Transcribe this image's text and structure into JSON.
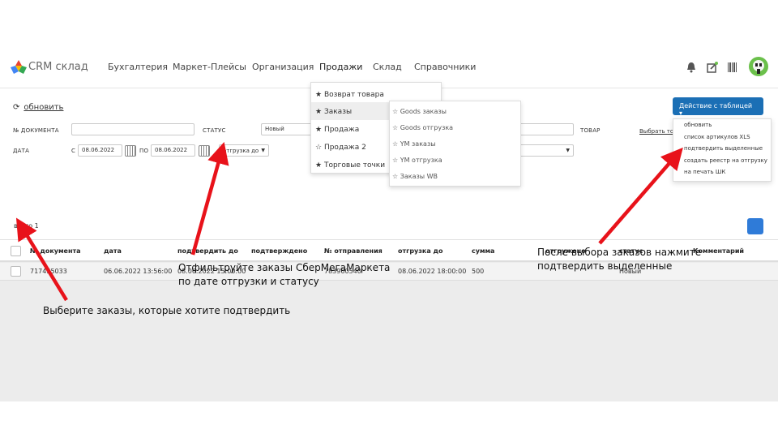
{
  "brand": "CRM склад",
  "menu": [
    {
      "label": "Бухгалтерия"
    },
    {
      "label": "Маркет-Плейсы"
    },
    {
      "label": "Организация"
    },
    {
      "label": "Продажи"
    },
    {
      "label": "Склад"
    },
    {
      "label": "Справочники"
    }
  ],
  "toolbar": {
    "refresh_label": "обновить"
  },
  "filters": {
    "doc_label": "№ ДОКУМЕНТА",
    "status_label": "СТАТУС",
    "status_value": "Новый",
    "date_label": "ДАТА",
    "from_prefix": "С",
    "from_value": "08.06.2022",
    "to_prefix": "ПО",
    "to_value": "08.06.2022",
    "date_type": "отгрузка до",
    "goods_label": "ТОВАР",
    "select_goods_link": "Выбрать тов"
  },
  "total": "всего 1",
  "action": {
    "button_label": "Действие с таблицей ▾",
    "items": [
      "обновить",
      "список артикулов XLS",
      "подтвердить выделенные",
      "создать реестр на отгрузку",
      "на печать ШК"
    ]
  },
  "sales_menu": {
    "items": [
      {
        "icon": "★",
        "label": "Возврат товара"
      },
      {
        "icon": "★",
        "label": "Заказы"
      },
      {
        "icon": "★",
        "label": "Продажа"
      },
      {
        "icon": "☆",
        "label": "Продажа 2"
      },
      {
        "icon": "★",
        "label": "Торговые точки"
      }
    ]
  },
  "orders_submenu": {
    "items": [
      {
        "icon": "☆",
        "label": "Goods заказы"
      },
      {
        "icon": "☆",
        "label": "Goods отгрузка"
      },
      {
        "icon": "☆",
        "label": "YM заказы"
      },
      {
        "icon": "☆",
        "label": "YM отгрузка"
      },
      {
        "icon": "☆",
        "label": "Заказы WB"
      }
    ]
  },
  "table": {
    "headers": [
      "№ документа",
      "дата",
      "подтвердить до",
      "подтверждено",
      "№ отправления",
      "отгрузка до",
      "сумма",
      "отгружено",
      "статус",
      "Комментарий"
    ],
    "rows": [
      [
        "717455033",
        "06.06.2022 13:56:00",
        "08.06.2022 15:00:00",
        "",
        "783960540",
        "08.06.2022 18:00:00",
        "500",
        "",
        "Новый",
        ""
      ]
    ]
  },
  "annotations": {
    "filter_line1": "Отфильтруйте заказы СберМегаМаркета",
    "filter_line2": "по дате отгрузки и статусу",
    "confirm_line1": "После выбора заказов нажмите",
    "confirm_line2": "подтвердить выделенные",
    "select_note": "Выберите заказы, которые хотите подтвердить"
  },
  "colors": {
    "accent": "#1b6fb5",
    "arrow": "#e8121a",
    "avatar": "#6bc04b"
  }
}
